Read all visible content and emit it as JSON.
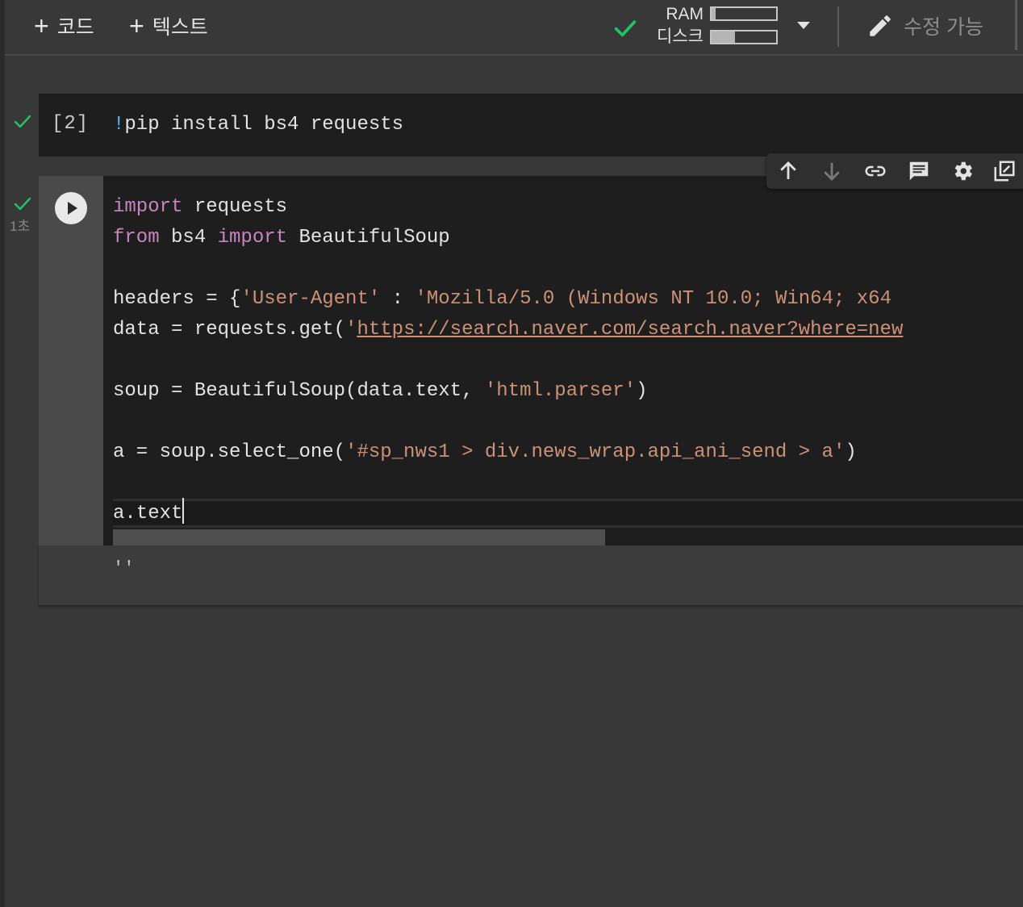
{
  "toolbar": {
    "add_code_label": "코드",
    "add_text_label": "텍스트",
    "ram_label": "RAM",
    "disk_label": "디스크",
    "ram_usage": 0.06,
    "disk_usage": 0.36,
    "edit_label": "수정 가능"
  },
  "cells": {
    "cell1": {
      "prompt": "[2]",
      "code": {
        "bang": "!",
        "rest": "pip install bs4 requests"
      }
    },
    "cell2": {
      "exec_time": "1초",
      "lines": {
        "l1": {
          "k1": "import",
          "t1": " requests"
        },
        "l2": {
          "k1": "from",
          "t1": " bs4 ",
          "k2": "import",
          "t2": " BeautifulSoup"
        },
        "l4": {
          "t1": "headers = {",
          "s1": "'User-Agent'",
          "t2": " : ",
          "s2": "'Mozilla/5.0 (Windows NT 10.0; Win64; x64"
        },
        "l5": {
          "t1": "data = requests.get(",
          "s1": "'",
          "u1": "https://search.naver.com/search.naver?where=new"
        },
        "l7": {
          "t1": "soup = BeautifulSoup(data.text, ",
          "s1": "'html.parser'",
          "t2": ")"
        },
        "l9": {
          "t1": "a = soup.select_one(",
          "s1": "'#sp_nws1 > div.news_wrap.api_ani_send > a'",
          "t2": ")"
        },
        "l11": {
          "t1": "a.text"
        }
      },
      "output": "''"
    }
  },
  "icons": {
    "toolbar": [
      "plus-icon",
      "check-icon",
      "dropdown-icon",
      "pencil-icon"
    ],
    "cell_toolbar": [
      "arrow-up-icon",
      "arrow-down-icon",
      "link-icon",
      "comment-icon",
      "gear-icon",
      "mirror-cell-icon"
    ]
  },
  "colors": {
    "keyword": "#c586c0",
    "string": "#ce9178",
    "bang": "#4fb3ff",
    "check": "#21c463",
    "editor_bg": "#1e1e1e",
    "page_bg": "#383838"
  }
}
